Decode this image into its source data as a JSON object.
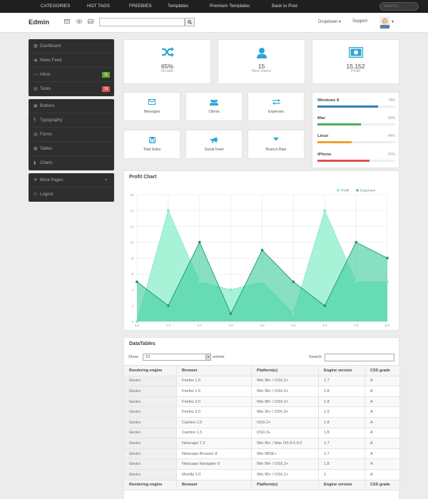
{
  "topnav": {
    "items": [
      "CATEGORIES",
      "HOT TAGS",
      "FREEBIES",
      "Templates",
      "Premium Templates",
      "Back to Post"
    ],
    "search_placeholder": "Search..."
  },
  "header": {
    "logo": "Edmin",
    "icons": [
      "envelope-icon",
      "eye-icon",
      "image-icon"
    ],
    "dropdown_label": "Dropdown ▾",
    "support_label": "Support",
    "avatar_caret": "▾"
  },
  "sidebar": {
    "group1": [
      {
        "label": "Dashboard",
        "icon": "dashboard-icon"
      },
      {
        "label": "News Feed",
        "icon": "bullhorn-icon"
      },
      {
        "label": "Inbox",
        "icon": "inbox-icon",
        "badge": "11",
        "badge_color": "#6aa527"
      },
      {
        "label": "Tasks",
        "icon": "tasks-icon",
        "badge": "19",
        "badge_color": "#d9534f"
      }
    ],
    "group2": [
      {
        "label": "Buttons",
        "icon": "buttons-icon"
      },
      {
        "label": "Typography",
        "icon": "typography-icon"
      },
      {
        "label": "Forms",
        "icon": "forms-icon"
      },
      {
        "label": "Tables",
        "icon": "tables-icon"
      },
      {
        "label": "Charts",
        "icon": "charts-icon"
      }
    ],
    "group3": [
      {
        "label": "More Pages",
        "icon": "more-pages-icon",
        "chevron": "⌄"
      },
      {
        "label": "Logout",
        "icon": "logout-icon"
      }
    ]
  },
  "stats": [
    {
      "value": "65%",
      "label": "Growth",
      "icon": "shuffle-icon"
    },
    {
      "value": "15",
      "label": "New Users",
      "icon": "user-icon"
    },
    {
      "value": "15,152",
      "label": "Profit",
      "icon": "money-icon"
    }
  ],
  "tiles": [
    {
      "label": "Messages",
      "icon": "envelope-icon"
    },
    {
      "label": "Clients",
      "icon": "group-icon"
    },
    {
      "label": "Expenses",
      "icon": "exchange-icon"
    },
    {
      "label": "Total Sales",
      "icon": "save-icon"
    },
    {
      "label": "Social Feed",
      "icon": "bullhorn-icon"
    },
    {
      "label": "Bounce Rate",
      "icon": "sort-down-icon"
    }
  ],
  "os_usage": [
    {
      "name": "Windows 8",
      "percent": "78%",
      "value": 0.78,
      "color": "#2a7fb8"
    },
    {
      "name": "Mac",
      "percent": "56%",
      "value": 0.56,
      "color": "#4caf50"
    },
    {
      "name": "Linux",
      "percent": "44%",
      "value": 0.44,
      "color": "#f0a030"
    },
    {
      "name": "iPhone",
      "percent": "67%",
      "value": 0.67,
      "color": "#d9534f"
    }
  ],
  "chart_title": "Profit Chart",
  "chart_data": {
    "type": "area",
    "title": "Profit Chart",
    "x": [
      0,
      1,
      2,
      3,
      4,
      5,
      6,
      7,
      8
    ],
    "x_tick_labels": [
      "0.0",
      "1.0",
      "2.0",
      "3.0",
      "4.0",
      "5.0",
      "6.0",
      "7.0",
      "8.0"
    ],
    "y_tick_labels": [
      "0",
      "2",
      "4",
      "6",
      "8",
      "10",
      "12",
      "14",
      "16"
    ],
    "ylim": [
      0,
      16
    ],
    "xlim": [
      0,
      8
    ],
    "grid": true,
    "legend_position": "top-right",
    "series": [
      {
        "name": "Profit",
        "values": [
          0,
          14,
          5,
          4,
          5,
          1,
          14,
          5,
          5
        ],
        "color": "#7fe8c5"
      },
      {
        "name": "Expenses",
        "values": [
          5,
          2,
          10,
          1,
          9,
          5,
          2,
          10,
          8
        ],
        "color": "#3fc59a"
      }
    ]
  },
  "datatable": {
    "title": "DataTables",
    "show_label": "Show",
    "show_value": "10",
    "entries_label": "entries",
    "search_label": "Search:",
    "columns": [
      "Rendering engine",
      "Browser",
      "Platform(s)",
      "Engine version",
      "CSS grade"
    ],
    "rows": [
      [
        "Gecko",
        "Firefox 1.0",
        "Win 98+ / OSX.2+",
        "1.7",
        "A"
      ],
      [
        "Gecko",
        "Firefox 1.5",
        "Win 98+ / OSX.2+",
        "1.8",
        "A"
      ],
      [
        "Gecko",
        "Firefox 2.0",
        "Win 98+ / OSX.2+",
        "1.8",
        "A"
      ],
      [
        "Gecko",
        "Firefox 3.0",
        "Win 2k+ / OSX.3+",
        "1.9",
        "A"
      ],
      [
        "Gecko",
        "Camino 1.0",
        "OSX.2+",
        "1.8",
        "A"
      ],
      [
        "Gecko",
        "Camino 1.5",
        "OSX.3+",
        "1.8",
        "A"
      ],
      [
        "Gecko",
        "Netscape 7.2",
        "Win 95+ / Mac OS 8.6-9.2",
        "1.7",
        "A"
      ],
      [
        "Gecko",
        "Netscape Browser 8",
        "Win 98SE+",
        "1.7",
        "A"
      ],
      [
        "Gecko",
        "Netscape Navigator 9",
        "Win 98+ / OSX.2+",
        "1.8",
        "A"
      ],
      [
        "Gecko",
        "Mozilla 1.0",
        "Win 95+ / OSX.1+",
        "1",
        "A"
      ]
    ]
  }
}
